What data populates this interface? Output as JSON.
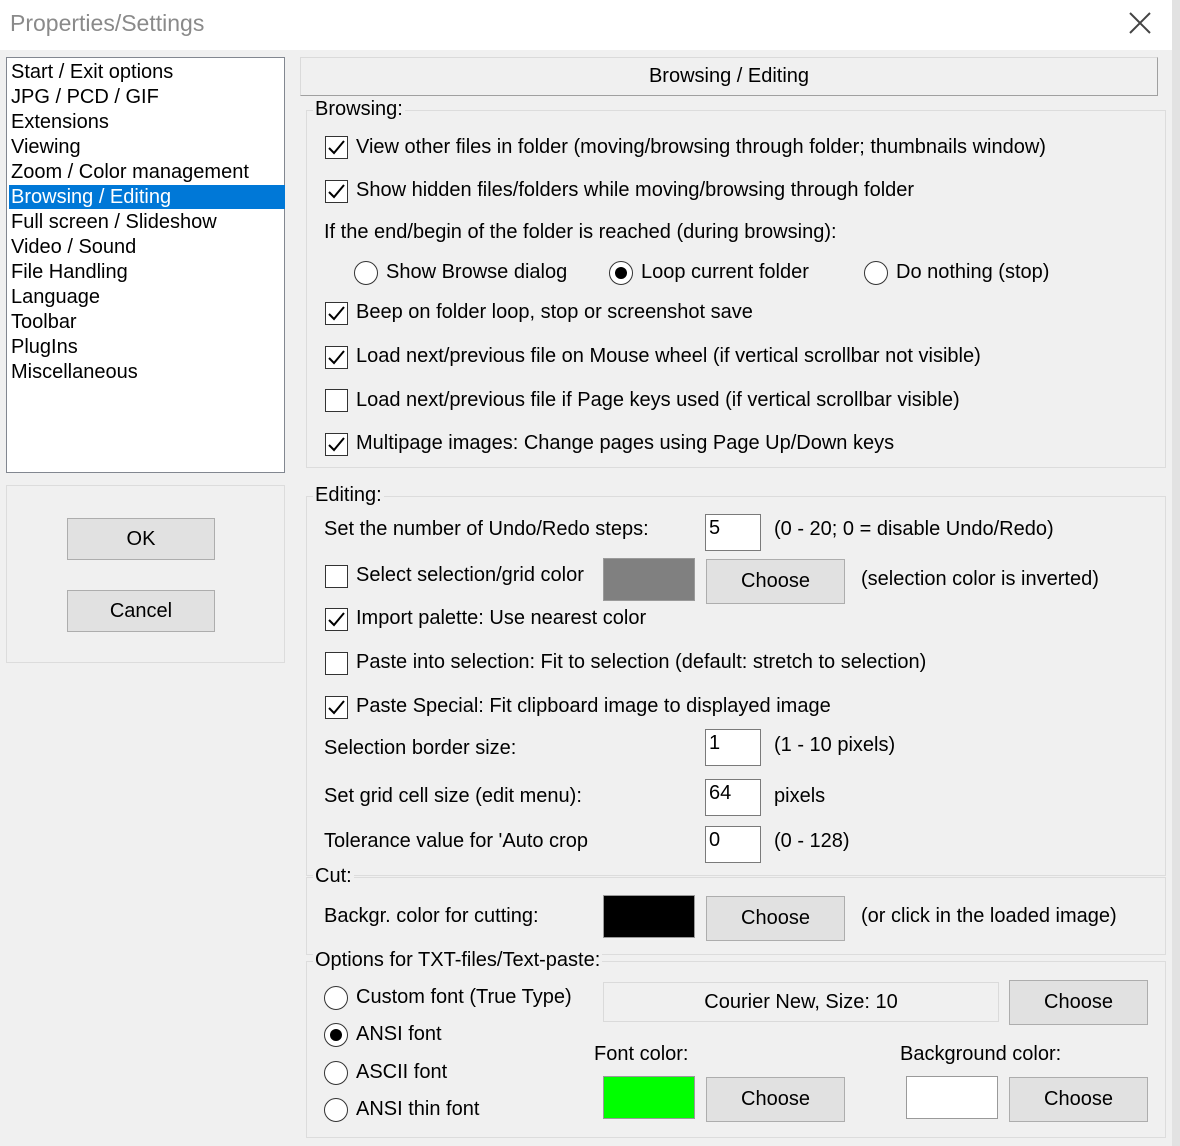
{
  "window": {
    "title": "Properties/Settings",
    "close_icon": "close-icon"
  },
  "sidebar": {
    "items": [
      {
        "label": "Start / Exit options"
      },
      {
        "label": "JPG / PCD / GIF"
      },
      {
        "label": "Extensions"
      },
      {
        "label": "Viewing"
      },
      {
        "label": "Zoom / Color management"
      },
      {
        "label": "Browsing / Editing",
        "selected": true
      },
      {
        "label": "Full screen / Slideshow"
      },
      {
        "label": "Video / Sound"
      },
      {
        "label": "File Handling"
      },
      {
        "label": "Language"
      },
      {
        "label": "Toolbar"
      },
      {
        "label": "PlugIns"
      },
      {
        "label": "Miscellaneous"
      }
    ]
  },
  "buttons": {
    "ok": "OK",
    "cancel": "Cancel"
  },
  "page": {
    "header": "Browsing / Editing"
  },
  "browsing": {
    "label": "Browsing:",
    "view_other_files": {
      "label": "View other files in folder (moving/browsing through folder; thumbnails window)",
      "checked": true
    },
    "show_hidden": {
      "label": "Show hidden files/folders while moving/browsing through folder",
      "checked": true
    },
    "end_folder_text": "If the end/begin of the folder is reached (during browsing):",
    "end_options": [
      {
        "label": "Show Browse dialog",
        "selected": false
      },
      {
        "label": "Loop current folder",
        "selected": true
      },
      {
        "label": "Do nothing (stop)",
        "selected": false
      }
    ],
    "beep": {
      "label": "Beep on folder loop, stop or screenshot save",
      "checked": true
    },
    "mouse_wheel": {
      "label": "Load next/previous file on Mouse wheel (if vertical scrollbar not visible)",
      "checked": true
    },
    "page_keys": {
      "label": "Load next/previous file if Page keys used (if vertical scrollbar visible)",
      "checked": false
    },
    "multipage": {
      "label": "Multipage images: Change pages using Page Up/Down keys",
      "checked": true
    }
  },
  "editing": {
    "label": "Editing:",
    "undo_label": "Set the number of Undo/Redo steps:",
    "undo_value": "5",
    "undo_hint": "(0 - 20; 0 = disable Undo/Redo)",
    "selection_color": {
      "label": "Select selection/grid color",
      "checked": false
    },
    "selection_swatch": "#808080",
    "choose_label": "Choose",
    "selection_hint": "(selection color is inverted)",
    "import_palette": {
      "label": "Import palette: Use nearest color",
      "checked": true
    },
    "paste_into": {
      "label": "Paste into selection: Fit to selection (default: stretch to selection)",
      "checked": false
    },
    "paste_special": {
      "label": "Paste Special: Fit clipboard image to displayed image",
      "checked": true
    },
    "border_label": "Selection border size:",
    "border_value": "1",
    "border_hint": "(1 - 10 pixels)",
    "grid_label": "Set grid cell size (edit menu):",
    "grid_value": "64",
    "grid_hint": "pixels",
    "tolerance_label": "Tolerance value for 'Auto crop",
    "tolerance_value": "0",
    "tolerance_hint": "(0 - 128)"
  },
  "cut": {
    "label": "Cut:",
    "bg_label": "Backgr. color for cutting:",
    "bg_swatch": "#000000",
    "choose_label": "Choose",
    "hint": "(or click in the loaded image)"
  },
  "txt": {
    "label": "Options for TXT-files/Text-paste:",
    "font_options": [
      {
        "label": "Custom font (True Type)",
        "selected": false
      },
      {
        "label": "ANSI font",
        "selected": true
      },
      {
        "label": "ASCII font",
        "selected": false
      },
      {
        "label": "ANSI thin font",
        "selected": false
      }
    ],
    "font_display": "Courier New, Size: 10",
    "choose_label": "Choose",
    "font_color_label": "Font color:",
    "font_color_swatch": "#00ff00",
    "bg_color_label": "Background color:",
    "bg_color_swatch": "#ffffff"
  }
}
